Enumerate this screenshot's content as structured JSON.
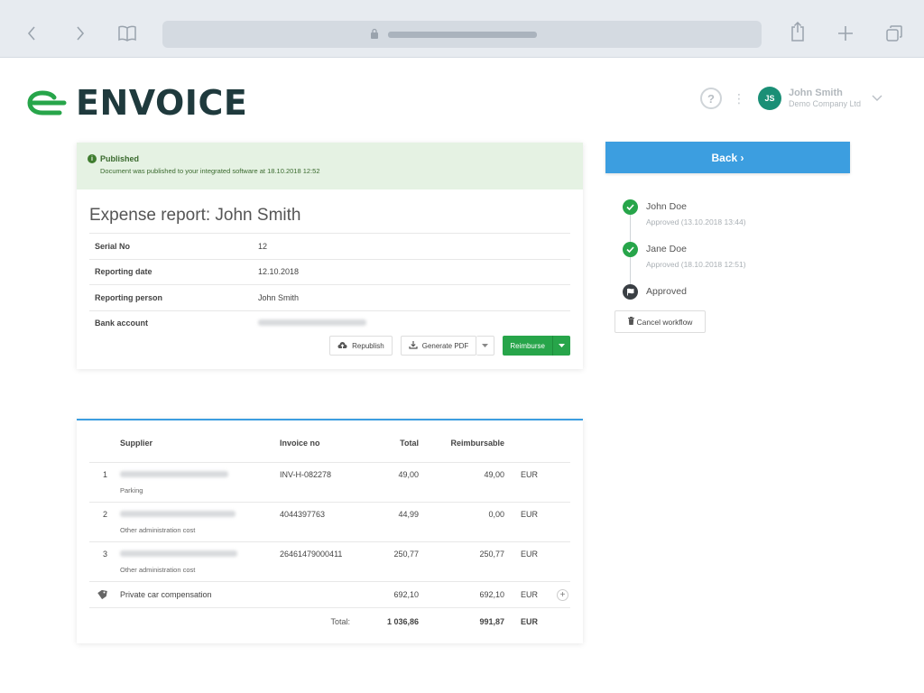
{
  "header": {
    "logo_text": "ENVOICE",
    "help_label": "?",
    "user": {
      "initials": "JS",
      "name": "John Smith",
      "company": "Demo Company Ltd"
    }
  },
  "banner": {
    "title": "Published",
    "message": "Document was published to your integrated software at 18.10.2018 12:52"
  },
  "report": {
    "title": "Expense report: John Smith",
    "fields": [
      {
        "label": "Serial No",
        "value": "12"
      },
      {
        "label": "Reporting date",
        "value": "12.10.2018"
      },
      {
        "label": "Reporting person",
        "value": "John Smith"
      },
      {
        "label": "Bank account",
        "value": ""
      }
    ],
    "actions": {
      "republish": "Republish",
      "generate_pdf": "Generate PDF",
      "reimburse": "Reimburse"
    }
  },
  "sidebar": {
    "back_label": "Back ›",
    "workflow": [
      {
        "name": "John Doe",
        "status": "Approved (13.10.2018 13:44)"
      },
      {
        "name": "Jane Doe",
        "status": "Approved (18.10.2018 12:51)"
      },
      {
        "name": "Approved",
        "status": ""
      }
    ],
    "cancel_label": "Cancel workflow"
  },
  "items": {
    "headers": {
      "supplier": "Supplier",
      "invoice_no": "Invoice no",
      "total": "Total",
      "reimbursable": "Reimbursable"
    },
    "rows": [
      {
        "num": "1",
        "category": "Parking",
        "invoice_no": "INV-H-082278",
        "total": "49,00",
        "reimbursable": "49,00",
        "currency": "EUR"
      },
      {
        "num": "2",
        "category": "Other administration cost",
        "invoice_no": "4044397763",
        "total": "44,99",
        "reimbursable": "0,00",
        "currency": "EUR"
      },
      {
        "num": "3",
        "category": "Other administration cost",
        "invoice_no": "26461479000411",
        "total": "250,77",
        "reimbursable": "250,77",
        "currency": "EUR"
      }
    ],
    "car": {
      "label": "Private car compensation",
      "total": "692,10",
      "reimbursable": "692,10",
      "currency": "EUR"
    },
    "totals": {
      "label": "Total:",
      "total": "1 036,86",
      "reimbursable": "991,87",
      "currency": "EUR"
    }
  },
  "colors": {
    "brand_green": "#27a54a",
    "accent_blue": "#3c9ee0",
    "banner_bg": "#e5f2e3",
    "logo_dark": "#1f3a3d"
  }
}
